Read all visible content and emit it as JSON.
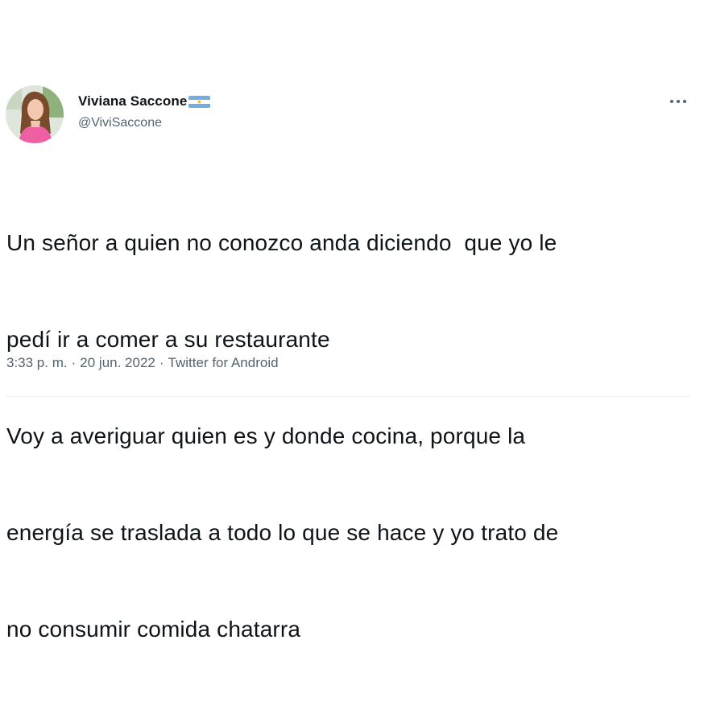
{
  "author": {
    "display_name": "Viviana Saccone",
    "flag_emoji_name": "argentina-flag-icon",
    "handle": "@ViviSaccone"
  },
  "tweet": {
    "lines": [
      "Un señor a quien no conozco anda diciendo  que yo le",
      "pedí ir a comer a su restaurante",
      "Voy a averiguar quien es y donde cocina, porque la",
      "energía se traslada a todo lo que se hace y yo trato de",
      "no consumir comida chatarra"
    ]
  },
  "meta": {
    "time": "3:33 p. m.",
    "separator": "·",
    "date": "20 jun. 2022",
    "source": "Twitter for Android"
  },
  "colors": {
    "text": "#0f1419",
    "secondary": "#536471",
    "divider": "#eff3f4",
    "flag_blue": "#74acdf",
    "avatar_top": "#f26ba8"
  }
}
